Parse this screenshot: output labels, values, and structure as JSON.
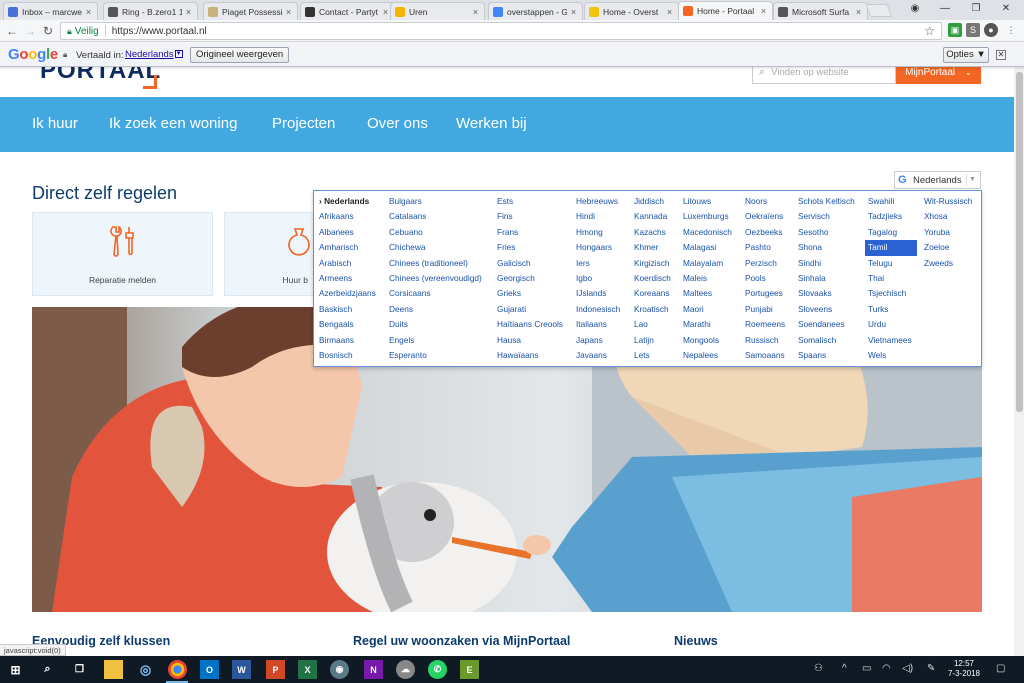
{
  "browser": {
    "tabs": [
      {
        "title": "Inbox – marcwe",
        "icon": "mail-icon",
        "color": "#4a6fd6"
      },
      {
        "title": "Ring - B.zero1 1",
        "icon": "bvlgari-icon",
        "color": "#555555"
      },
      {
        "title": "Piaget Possessi",
        "icon": "piaget-icon",
        "color": "#c9b27a"
      },
      {
        "title": "Contact - Partyt",
        "icon": "w-icon",
        "color": "#333333"
      },
      {
        "title": "Uren",
        "icon": "drive-icon",
        "color": "#f4b400"
      },
      {
        "title": "overstappen - G",
        "icon": "google-icon",
        "color": "#4285f4"
      },
      {
        "title": "Home - Overst",
        "icon": "loading-icon",
        "color": "#f1c40f"
      },
      {
        "title": "Home - Portaal",
        "icon": "portaal-icon",
        "color": "#f26522"
      },
      {
        "title": "Microsoft Surfa",
        "icon": "g-icon",
        "color": "#555555"
      }
    ],
    "active_tab": 7,
    "secure_label": "Veilig",
    "url": "https://www.portaal.nl"
  },
  "translate_bar": {
    "brand": [
      "G",
      "o",
      "o",
      "g",
      "l",
      "e"
    ],
    "label": "Vertaald in:",
    "language": "Nederlands",
    "original_button": "Origineel weergeven",
    "options_button": "Opties ▼"
  },
  "site": {
    "logo": "PORTAAL",
    "search_placeholder": "Vinden op website",
    "mijnportaal": "MijnPortaal",
    "nav": [
      "Ik huur",
      "Ik zoek een woning",
      "Projecten",
      "Over ons",
      "Werken bij"
    ],
    "section_title": "Direct zelf regelen",
    "cards": [
      {
        "label": "Reparatie melden"
      },
      {
        "label": "Huur b"
      }
    ],
    "translate_widget": "Nederlands",
    "footer_headings": [
      "Eenvoudig zelf klussen",
      "Regel uw woonzaken via MijnPortaal",
      "Nieuws"
    ]
  },
  "languages": {
    "current": "› Nederlands",
    "highlighted": "Tamil",
    "columns": [
      [
        "› Nederlands",
        "Afrikaans",
        "Albanees",
        "Amharisch",
        "Arabisch",
        "Armeens",
        "Azerbeidzjaans",
        "Baskisch",
        "Bengaals",
        "Birmaans",
        "Bosnisch"
      ],
      [
        "Bulgaars",
        "Catalaans",
        "Cebuano",
        "Chichewa",
        "Chinees (traditioneel)",
        "Chinees (vereenvoudigd)",
        "Corsicaans",
        "Deens",
        "Duits",
        "Engels",
        "Esperanto"
      ],
      [
        "Ests",
        "Fins",
        "Frans",
        "Fries",
        "Galicisch",
        "Georgisch",
        "Grieks",
        "Gujarati",
        "Haïtiaans Creools",
        "Hausa",
        "Hawaïaans"
      ],
      [
        "Hebreeuws",
        "Hindi",
        "Hmong",
        "Hongaars",
        "Iers",
        "Igbo",
        "IJslands",
        "Indonesisch",
        "Italiaans",
        "Japans",
        "Javaans"
      ],
      [
        "Jiddisch",
        "Kannada",
        "Kazachs",
        "Khmer",
        "Kirgizisch",
        "Koerdisch",
        "Koreaans",
        "Kroatisch",
        "Lao",
        "Latijn",
        "Lets"
      ],
      [
        "Litouws",
        "Luxemburgs",
        "Macedonisch",
        "Malagasi",
        "Malayalam",
        "Maleis",
        "Maltees",
        "Maori",
        "Marathi",
        "Mongools",
        "Nepalees"
      ],
      [
        "Noors",
        "Oekraïens",
        "Oezbeeks",
        "Pashto",
        "Perzisch",
        "Pools",
        "Portugees",
        "Punjabi",
        "Roemeens",
        "Russisch",
        "Samoaans"
      ],
      [
        "Schots Keltisch",
        "Servisch",
        "Sesotho",
        "Shona",
        "Sindhi",
        "Sinhala",
        "Slovaaks",
        "Sloveens",
        "Soendanees",
        "Somalisch",
        "Spaans"
      ],
      [
        "Swahili",
        "Tadzjieks",
        "Tagalog",
        "Tamil",
        "Telugu",
        "Thai",
        "Tsjechisch",
        "Turks",
        "Urdu",
        "Vietnamees",
        "Wels"
      ],
      [
        "Wit-Russisch",
        "Xhosa",
        "Yoruba",
        "Zoeloe",
        "Zweeds"
      ]
    ]
  },
  "status_text": "javascript:void(0)",
  "taskbar": {
    "time": "12:57",
    "date": "7-3-2018"
  }
}
